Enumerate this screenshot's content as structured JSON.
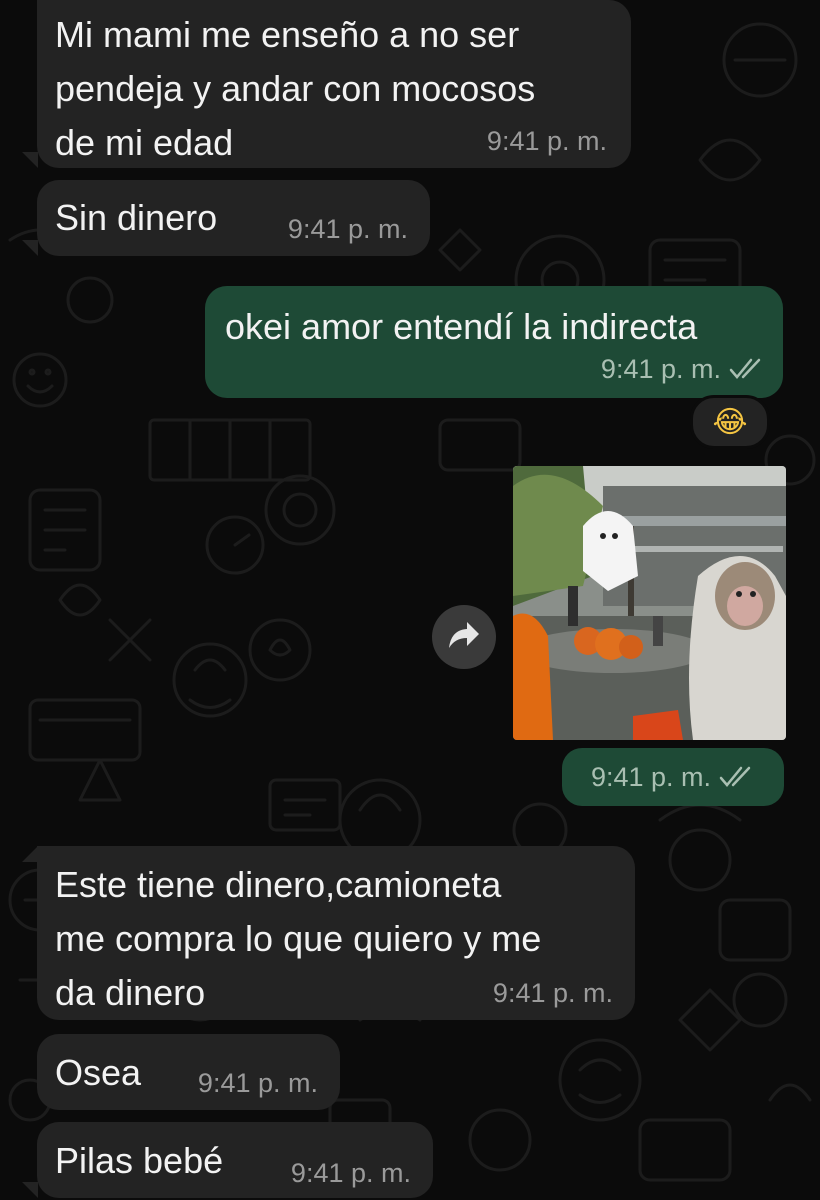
{
  "colors": {
    "background": "#0b0b0b",
    "incoming_bubble": "#232323",
    "outgoing_bubble": "#1e4a36",
    "message_text": "#f2f2f2",
    "timestamp": "#9a9a9a",
    "read_ticks": "#a9bfb2"
  },
  "messages": [
    {
      "direction": "incoming",
      "text": "Mi mami me enseño a no ser\npendeja y andar con mocosos\nde mi edad",
      "time": "9:41 p. m."
    },
    {
      "direction": "incoming",
      "text": "Sin dinero",
      "time": "9:41 p. m."
    },
    {
      "direction": "outgoing",
      "text": "okei amor entendí la indirecta",
      "time": "9:41 p. m.",
      "status_icon": "double-check-icon"
    },
    {
      "direction": "outgoing",
      "type": "video",
      "time": "9:41 p. m.",
      "status_icon": "double-check-icon",
      "reaction": "😂",
      "forward_icon": "forward-arrow-icon"
    },
    {
      "direction": "incoming",
      "text": "Este tiene dinero,camioneta\nme compra lo que quiero y me\nda dinero",
      "time": "9:41 p. m."
    },
    {
      "direction": "incoming",
      "text": "Osea",
      "time": "9:41 p. m."
    },
    {
      "direction": "incoming",
      "text": "Pilas bebé",
      "time": "9:41 p. m."
    }
  ]
}
